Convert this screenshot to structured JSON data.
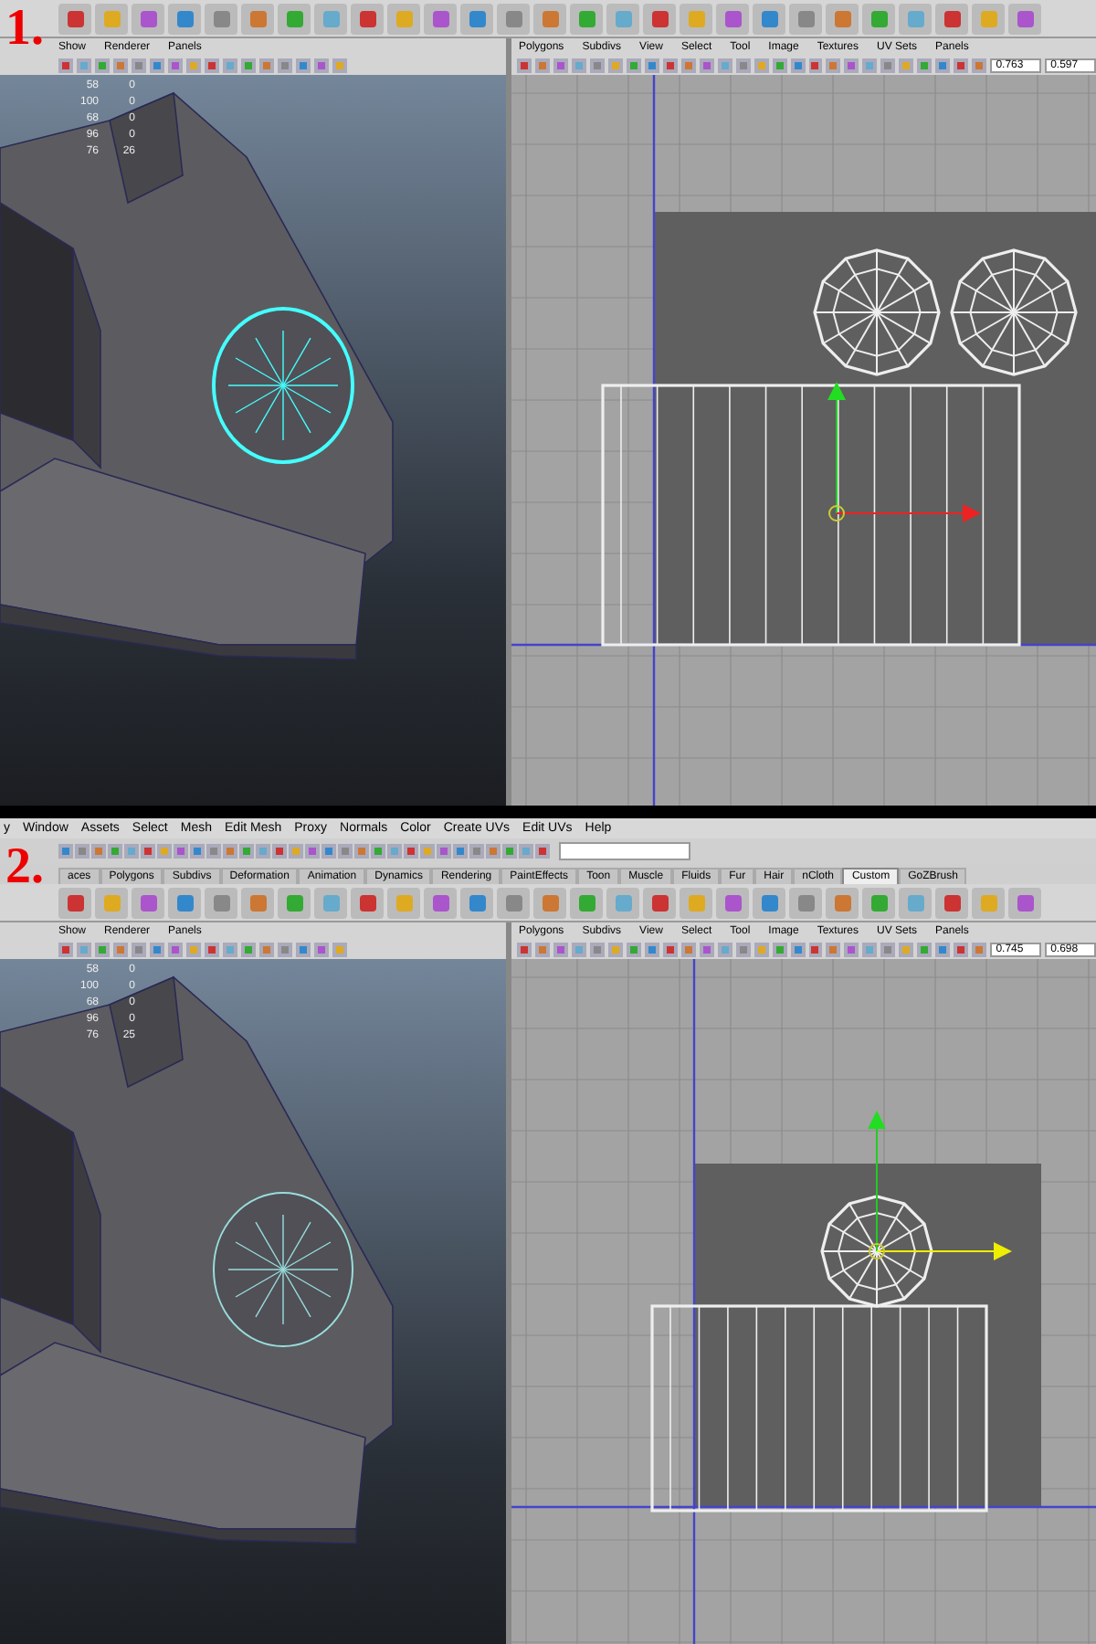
{
  "steps": [
    {
      "label": "1.",
      "viewport_menu": [
        "Show",
        "Renderer",
        "Panels"
      ],
      "uv_menu": [
        "Polygons",
        "Subdivs",
        "View",
        "Select",
        "Tool",
        "Image",
        "Textures",
        "UV Sets",
        "Panels"
      ],
      "uv_fields": [
        "0.763",
        "0.597"
      ],
      "hud": [
        [
          "58",
          "0"
        ],
        [
          "100",
          "0"
        ],
        [
          "68",
          "0"
        ],
        [
          "96",
          "0"
        ],
        [
          "76",
          "26"
        ]
      ]
    },
    {
      "label": "2.",
      "menu_bar": [
        "y",
        "Window",
        "Assets",
        "Select",
        "Mesh",
        "Edit Mesh",
        "Proxy",
        "Normals",
        "Color",
        "Create UVs",
        "Edit UVs",
        "Help"
      ],
      "shelf_tabs": [
        {
          "label": "aces",
          "selected": false
        },
        {
          "label": "Polygons",
          "selected": false
        },
        {
          "label": "Subdivs",
          "selected": false
        },
        {
          "label": "Deformation",
          "selected": false
        },
        {
          "label": "Animation",
          "selected": false
        },
        {
          "label": "Dynamics",
          "selected": false
        },
        {
          "label": "Rendering",
          "selected": false
        },
        {
          "label": "PaintEffects",
          "selected": false
        },
        {
          "label": "Toon",
          "selected": false
        },
        {
          "label": "Muscle",
          "selected": false
        },
        {
          "label": "Fluids",
          "selected": false
        },
        {
          "label": "Fur",
          "selected": false
        },
        {
          "label": "Hair",
          "selected": false
        },
        {
          "label": "nCloth",
          "selected": false
        },
        {
          "label": "Custom",
          "selected": true
        },
        {
          "label": "GoZBrush",
          "selected": false
        }
      ],
      "viewport_menu": [
        "Show",
        "Renderer",
        "Panels"
      ],
      "uv_menu": [
        "Polygons",
        "Subdivs",
        "View",
        "Select",
        "Tool",
        "Image",
        "Textures",
        "UV Sets",
        "Panels"
      ],
      "uv_fields": [
        "0.745",
        "0.698"
      ],
      "hud": [
        [
          "58",
          "0"
        ],
        [
          "100",
          "0"
        ],
        [
          "68",
          "0"
        ],
        [
          "96",
          "0"
        ],
        [
          "76",
          "25"
        ]
      ]
    }
  ]
}
